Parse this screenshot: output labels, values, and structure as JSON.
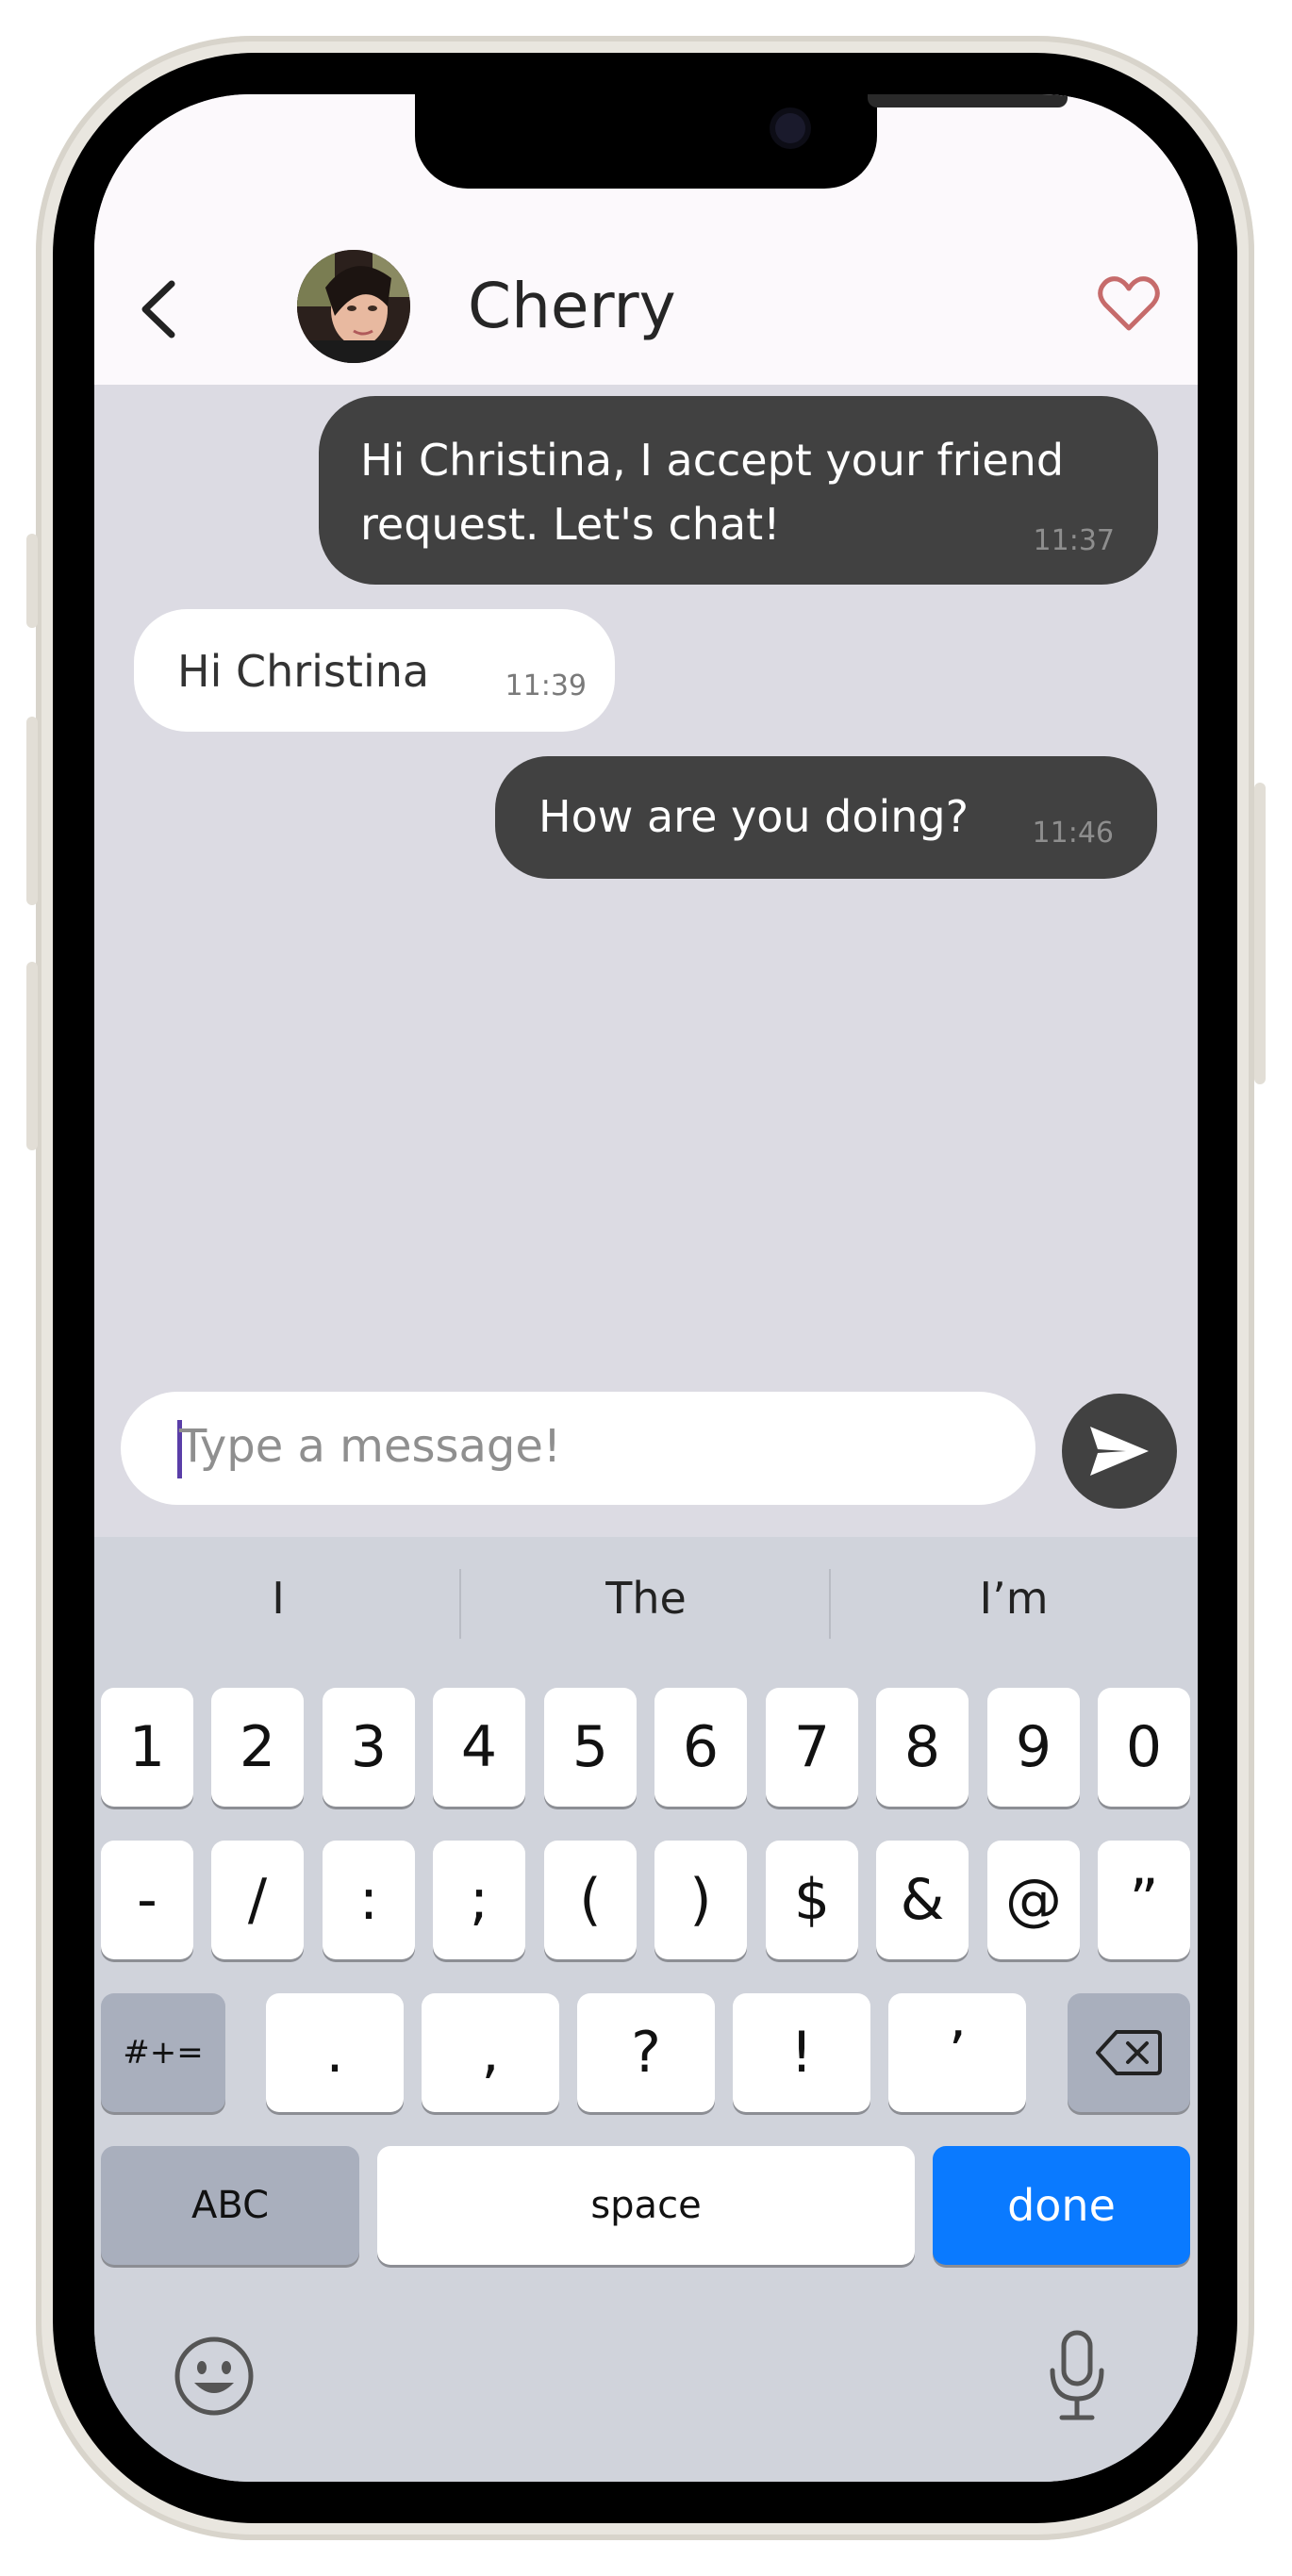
{
  "contact": {
    "name": "Cherry",
    "avatar": "cherry-avatar-photo"
  },
  "icons": {
    "back": "chevron-left-icon",
    "favorite": "heart-outline-icon",
    "send": "send-arrow-icon",
    "emoji": "emoji-face-icon",
    "mic": "microphone-icon",
    "delete": "backspace-icon"
  },
  "colors": {
    "heart": "#c66b6b",
    "outgoing_bubble": "#414141",
    "incoming_bubble": "#ffffff",
    "done_key": "#0a7aff"
  },
  "messages": [
    {
      "direction": "outgoing",
      "text_line1": "Hi Christina, I accept your friend",
      "text_line2": "request. Let's chat!",
      "time": "11:37"
    },
    {
      "direction": "incoming",
      "text": "Hi Christina",
      "time": "11:39"
    },
    {
      "direction": "outgoing",
      "text": "How are you doing?",
      "time": "11:46"
    }
  ],
  "composer": {
    "placeholder": "Type a message!"
  },
  "keyboard": {
    "suggestions": [
      "I",
      "The",
      "I’m"
    ],
    "row1": [
      "1",
      "2",
      "3",
      "4",
      "5",
      "6",
      "7",
      "8",
      "9",
      "0"
    ],
    "row2": [
      "-",
      "/",
      ":",
      ";",
      "(",
      ")",
      "$",
      "&",
      "@",
      "”"
    ],
    "row3": {
      "toggle": "#+=",
      "keys": [
        ".",
        ",",
        "?",
        "!",
        "’"
      ]
    },
    "row4": {
      "abc": "ABC",
      "space": "space",
      "done": "done"
    }
  }
}
